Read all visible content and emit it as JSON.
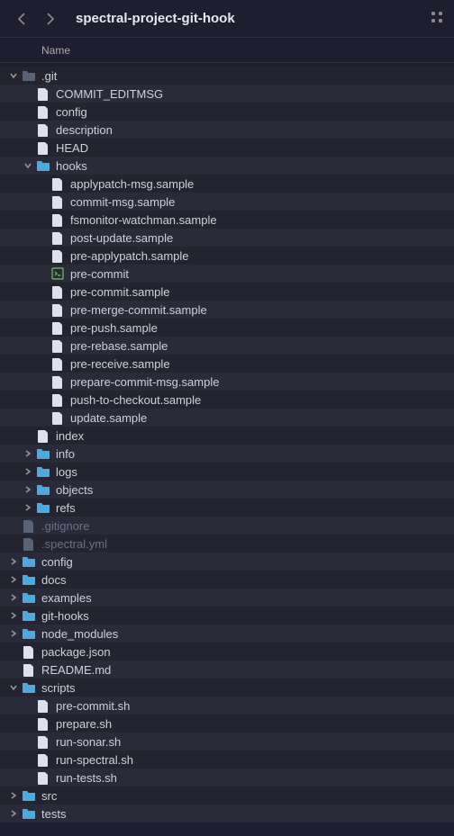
{
  "header": {
    "title": "spectral-project-git-hook",
    "column": "Name"
  },
  "tree": [
    {
      "depth": 0,
      "exp": "down",
      "type": "folder-dim",
      "label": ".git",
      "dim": false
    },
    {
      "depth": 1,
      "exp": null,
      "type": "file",
      "label": "COMMIT_EDITMSG",
      "dim": false
    },
    {
      "depth": 1,
      "exp": null,
      "type": "file",
      "label": "config",
      "dim": false
    },
    {
      "depth": 1,
      "exp": null,
      "type": "file",
      "label": "description",
      "dim": false
    },
    {
      "depth": 1,
      "exp": null,
      "type": "file",
      "label": "HEAD",
      "dim": false
    },
    {
      "depth": 1,
      "exp": "down",
      "type": "folder",
      "label": "hooks",
      "dim": false
    },
    {
      "depth": 2,
      "exp": null,
      "type": "file",
      "label": "applypatch-msg.sample",
      "dim": false
    },
    {
      "depth": 2,
      "exp": null,
      "type": "file",
      "label": "commit-msg.sample",
      "dim": false
    },
    {
      "depth": 2,
      "exp": null,
      "type": "file",
      "label": "fsmonitor-watchman.sample",
      "dim": false
    },
    {
      "depth": 2,
      "exp": null,
      "type": "file",
      "label": "post-update.sample",
      "dim": false
    },
    {
      "depth": 2,
      "exp": null,
      "type": "file",
      "label": "pre-applypatch.sample",
      "dim": false
    },
    {
      "depth": 2,
      "exp": null,
      "type": "exec",
      "label": "pre-commit",
      "dim": false
    },
    {
      "depth": 2,
      "exp": null,
      "type": "file",
      "label": "pre-commit.sample",
      "dim": false
    },
    {
      "depth": 2,
      "exp": null,
      "type": "file",
      "label": "pre-merge-commit.sample",
      "dim": false
    },
    {
      "depth": 2,
      "exp": null,
      "type": "file",
      "label": "pre-push.sample",
      "dim": false
    },
    {
      "depth": 2,
      "exp": null,
      "type": "file",
      "label": "pre-rebase.sample",
      "dim": false
    },
    {
      "depth": 2,
      "exp": null,
      "type": "file",
      "label": "pre-receive.sample",
      "dim": false
    },
    {
      "depth": 2,
      "exp": null,
      "type": "file",
      "label": "prepare-commit-msg.sample",
      "dim": false
    },
    {
      "depth": 2,
      "exp": null,
      "type": "file",
      "label": "push-to-checkout.sample",
      "dim": false
    },
    {
      "depth": 2,
      "exp": null,
      "type": "file",
      "label": "update.sample",
      "dim": false
    },
    {
      "depth": 1,
      "exp": null,
      "type": "file",
      "label": "index",
      "dim": false
    },
    {
      "depth": 1,
      "exp": "right",
      "type": "folder",
      "label": "info",
      "dim": false
    },
    {
      "depth": 1,
      "exp": "right",
      "type": "folder",
      "label": "logs",
      "dim": false
    },
    {
      "depth": 1,
      "exp": "right",
      "type": "folder",
      "label": "objects",
      "dim": false
    },
    {
      "depth": 1,
      "exp": "right",
      "type": "folder",
      "label": "refs",
      "dim": false
    },
    {
      "depth": 0,
      "exp": null,
      "type": "file-dim",
      "label": ".gitignore",
      "dim": true
    },
    {
      "depth": 0,
      "exp": null,
      "type": "file-dim",
      "label": ".spectral.yml",
      "dim": true
    },
    {
      "depth": 0,
      "exp": "right",
      "type": "folder",
      "label": "config",
      "dim": false
    },
    {
      "depth": 0,
      "exp": "right",
      "type": "folder",
      "label": "docs",
      "dim": false
    },
    {
      "depth": 0,
      "exp": "right",
      "type": "folder",
      "label": "examples",
      "dim": false
    },
    {
      "depth": 0,
      "exp": "right",
      "type": "folder",
      "label": "git-hooks",
      "dim": false
    },
    {
      "depth": 0,
      "exp": "right",
      "type": "folder",
      "label": "node_modules",
      "dim": false
    },
    {
      "depth": 0,
      "exp": null,
      "type": "file",
      "label": "package.json",
      "dim": false
    },
    {
      "depth": 0,
      "exp": null,
      "type": "file",
      "label": "README.md",
      "dim": false
    },
    {
      "depth": 0,
      "exp": "down",
      "type": "folder",
      "label": "scripts",
      "dim": false
    },
    {
      "depth": 1,
      "exp": null,
      "type": "file",
      "label": "pre-commit.sh",
      "dim": false
    },
    {
      "depth": 1,
      "exp": null,
      "type": "file",
      "label": "prepare.sh",
      "dim": false
    },
    {
      "depth": 1,
      "exp": null,
      "type": "file",
      "label": "run-sonar.sh",
      "dim": false
    },
    {
      "depth": 1,
      "exp": null,
      "type": "file",
      "label": "run-spectral.sh",
      "dim": false
    },
    {
      "depth": 1,
      "exp": null,
      "type": "file",
      "label": "run-tests.sh",
      "dim": false
    },
    {
      "depth": 0,
      "exp": "right",
      "type": "folder",
      "label": "src",
      "dim": false
    },
    {
      "depth": 0,
      "exp": "right",
      "type": "folder",
      "label": "tests",
      "dim": false
    }
  ]
}
